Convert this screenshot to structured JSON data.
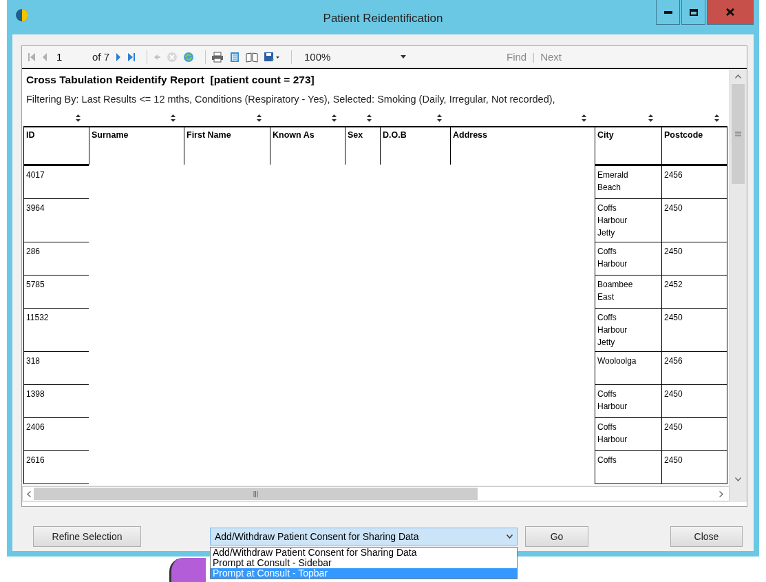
{
  "window": {
    "title": "Patient Reidentification"
  },
  "toolbar": {
    "page": "1",
    "page_count": "of 7",
    "zoom": "100%",
    "find_label": "Find",
    "find_separator": "|",
    "next_label": "Next"
  },
  "report": {
    "title": "Cross Tabulation Reidentify Report  [patient count = 273]",
    "filter": "Filtering By: Last Results <= 12 mths, Conditions (Respiratory - Yes), Selected: Smoking (Daily, Irregular, Not recorded),",
    "columns": [
      "ID",
      "Surname",
      "First Name",
      "Known As",
      "Sex",
      "D.O.B",
      "Address",
      "City",
      "Postcode"
    ],
    "rows": [
      {
        "id": "4017",
        "city": "Emerald Beach",
        "postcode": "2456"
      },
      {
        "id": "3964",
        "city": "Coffs Harbour Jetty",
        "postcode": "2450"
      },
      {
        "id": "286",
        "city": "Coffs Harbour",
        "postcode": "2450"
      },
      {
        "id": "5785",
        "city": "Boambee East",
        "postcode": "2452"
      },
      {
        "id": "11532",
        "city": "Coffs Harbour Jetty",
        "postcode": "2450"
      },
      {
        "id": "318",
        "city": "Wooloolga",
        "postcode": "2456"
      },
      {
        "id": "1398",
        "city": "Coffs Harbour",
        "postcode": "2450"
      },
      {
        "id": "2406",
        "city": "Coffs Harbour",
        "postcode": "2450"
      },
      {
        "id": "2616",
        "city": "Coffs",
        "postcode": "2450"
      }
    ]
  },
  "buttons": {
    "refine": "Refine Selection",
    "go": "Go",
    "close": "Close"
  },
  "action_dropdown": {
    "value": "Add/Withdraw Patient Consent for Sharing Data",
    "options": [
      {
        "label": "Add/Withdraw Patient Consent for Sharing Data",
        "highlighted": false
      },
      {
        "label": "Prompt at Consult - Sidebar",
        "highlighted": false
      },
      {
        "label": "Prompt at Consult - Topbar",
        "highlighted": true
      }
    ]
  }
}
